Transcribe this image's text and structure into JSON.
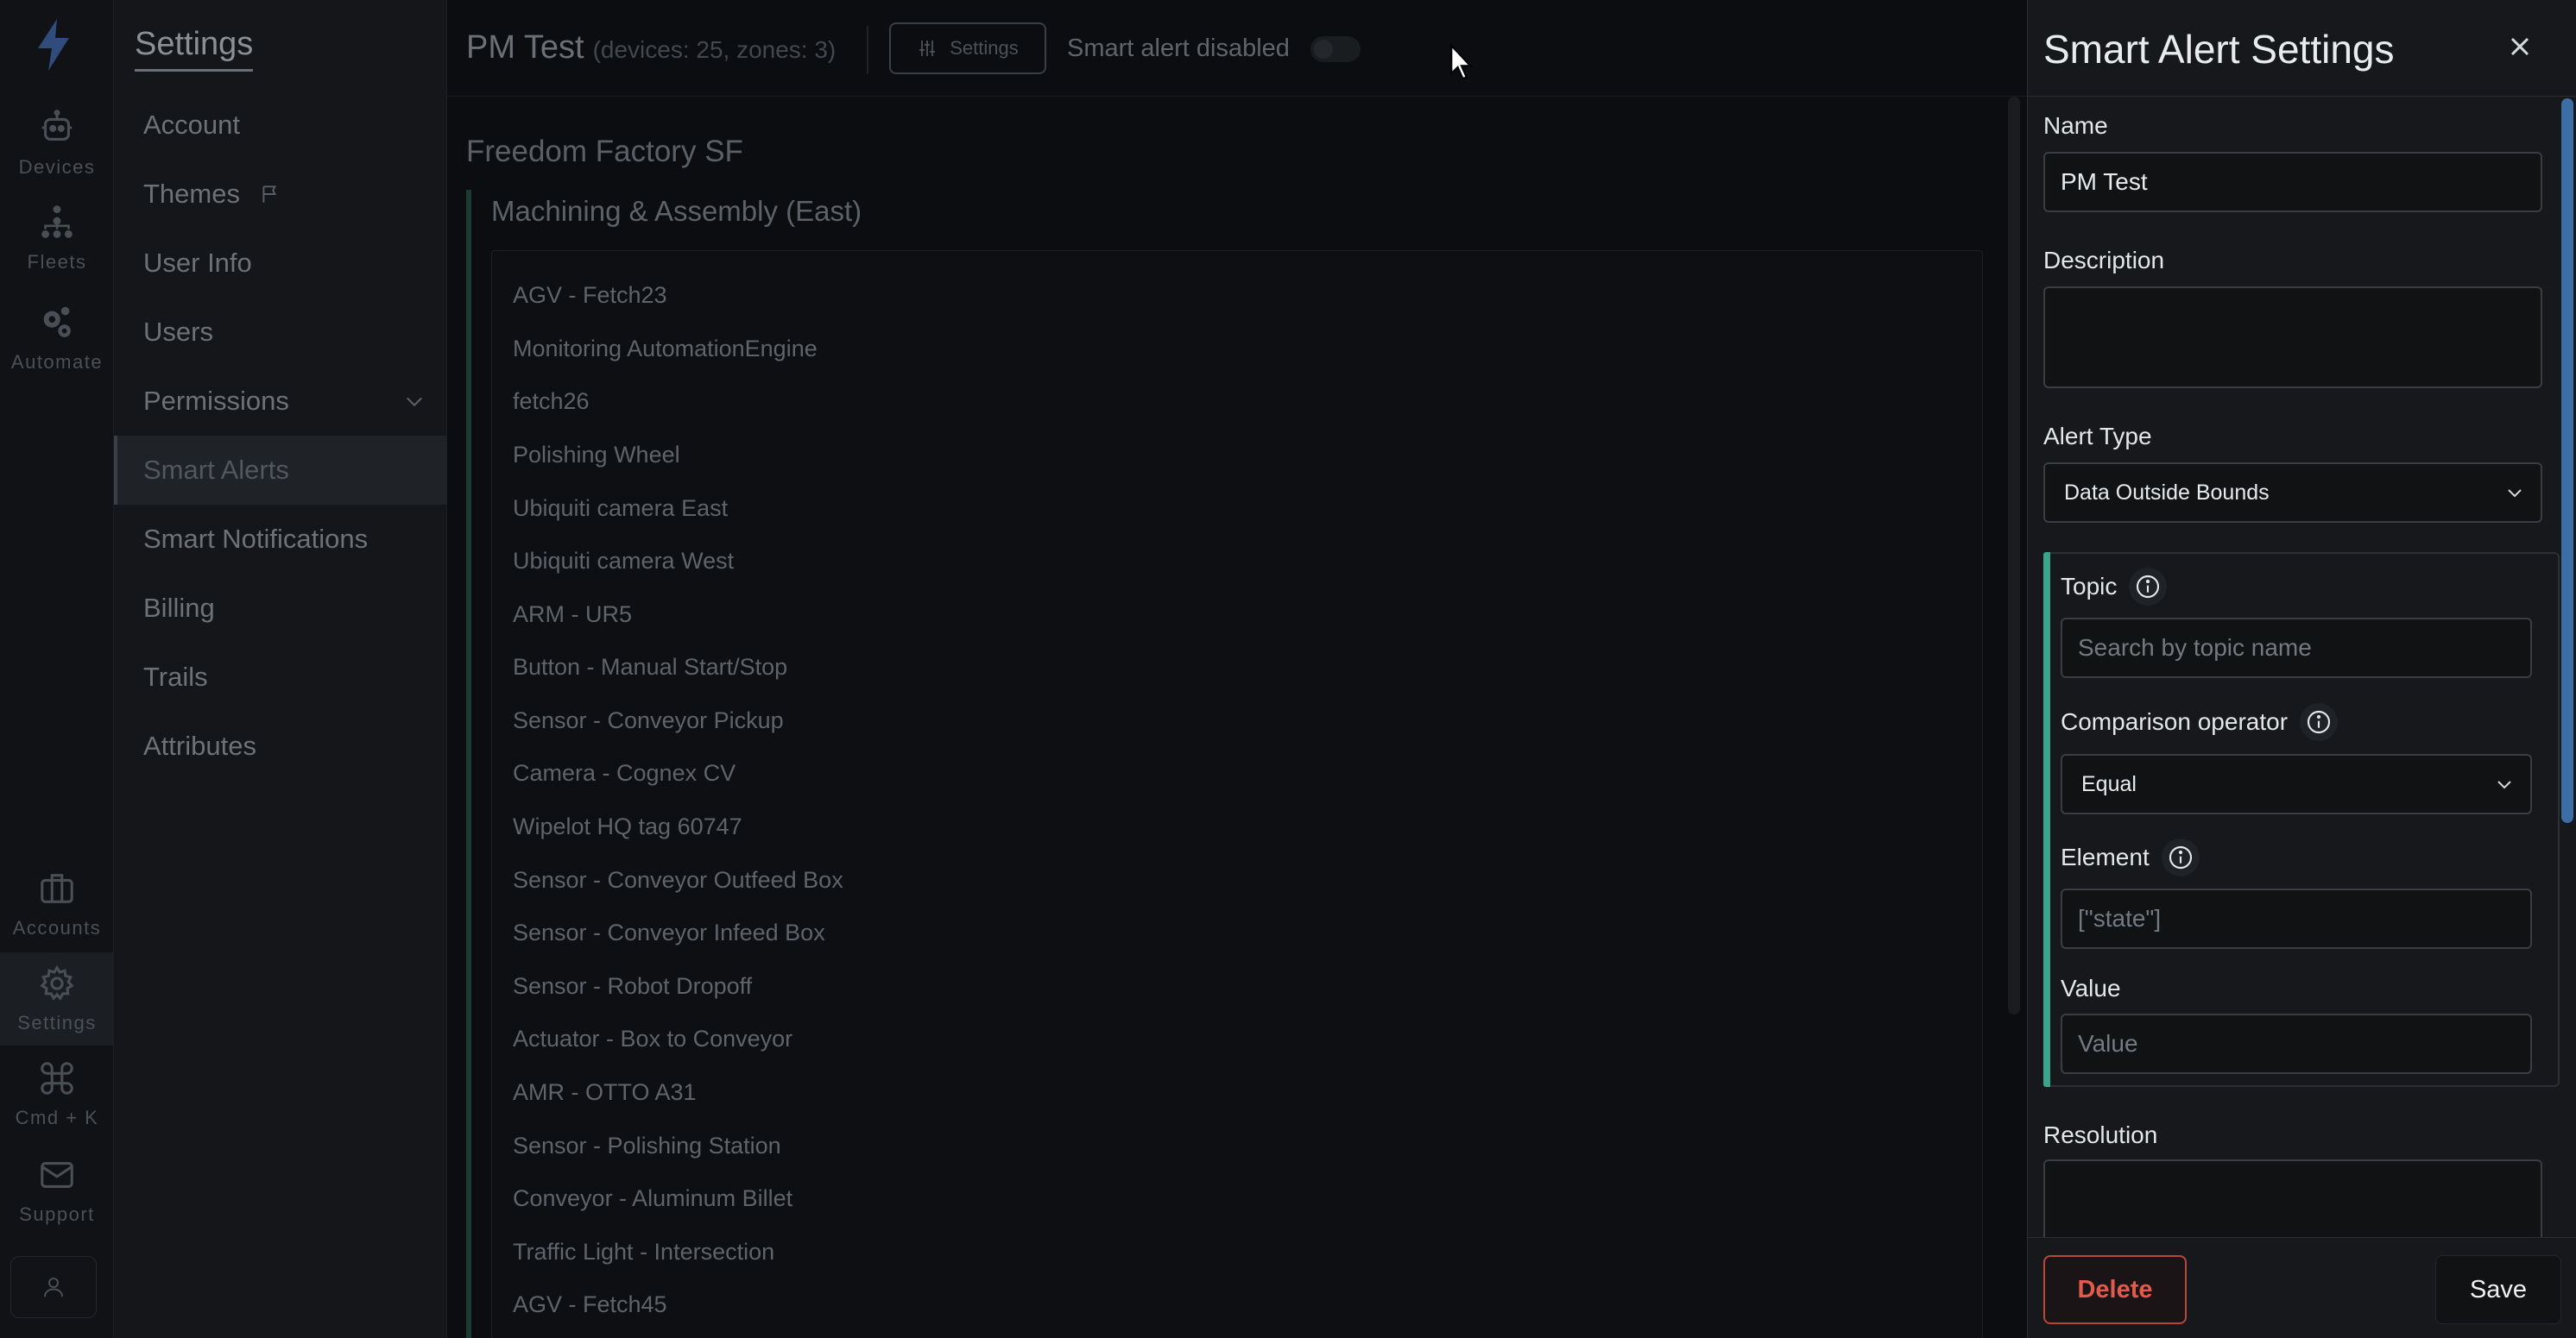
{
  "rail": {
    "items": [
      {
        "label": "Devices",
        "icon": "robot-icon"
      },
      {
        "label": "Fleets",
        "icon": "hierarchy-icon"
      },
      {
        "label": "Automate",
        "icon": "gears-icon"
      },
      {
        "label": "Accounts",
        "icon": "briefcase-icon"
      },
      {
        "label": "Settings",
        "icon": "gear-icon"
      },
      {
        "label": "Cmd + K",
        "icon": "command-icon"
      },
      {
        "label": "Support",
        "icon": "envelope-icon"
      }
    ]
  },
  "menu": {
    "title": "Settings",
    "items": [
      {
        "label": "Account"
      },
      {
        "label": "Themes"
      },
      {
        "label": "User Info"
      },
      {
        "label": "Users"
      },
      {
        "label": "Permissions"
      },
      {
        "label": "Smart Alerts"
      },
      {
        "label": "Smart Notifications"
      },
      {
        "label": "Billing"
      },
      {
        "label": "Trails"
      },
      {
        "label": "Attributes"
      }
    ]
  },
  "main": {
    "title": "PM Test",
    "meta": "(devices: 25, zones: 3)",
    "settings_button": "Settings",
    "alert_status": "Smart alert disabled",
    "site": "Freedom Factory SF",
    "zone": "Machining & Assembly (East)",
    "devices": [
      "AGV - Fetch23",
      "Monitoring AutomationEngine",
      "fetch26",
      "Polishing Wheel",
      "Ubiquiti camera East",
      "Ubiquiti camera West",
      "ARM - UR5",
      "Button - Manual Start/Stop",
      "Sensor - Conveyor Pickup",
      "Camera - Cognex CV",
      "Wipelot HQ tag 60747",
      "Sensor - Conveyor Outfeed Box",
      "Sensor - Conveyor Infeed Box",
      "Sensor - Robot Dropoff",
      "Actuator - Box to Conveyor",
      "AMR - OTTO A31",
      "Sensor - Polishing Station",
      "Conveyor - Aluminum Billet",
      "Traffic Light - Intersection",
      "AGV - Fetch45"
    ]
  },
  "drawer": {
    "title": "Smart Alert Settings",
    "name_label": "Name",
    "name_value": "PM Test",
    "description_label": "Description",
    "description_value": "",
    "alert_type_label": "Alert Type",
    "alert_type_value": "Data Outside Bounds",
    "topic_label": "Topic",
    "topic_placeholder": "Search by topic name",
    "operator_label": "Comparison operator",
    "operator_value": "Equal",
    "element_label": "Element",
    "element_placeholder": "[\"state\"]",
    "value_label": "Value",
    "value_placeholder": "Value",
    "resolution_label": "Resolution",
    "delete_label": "Delete",
    "save_label": "Save"
  },
  "colors": {
    "accent_green": "#3aa58a",
    "danger": "#e05b4a",
    "scrollbar_blue": "#3c6ea6"
  }
}
